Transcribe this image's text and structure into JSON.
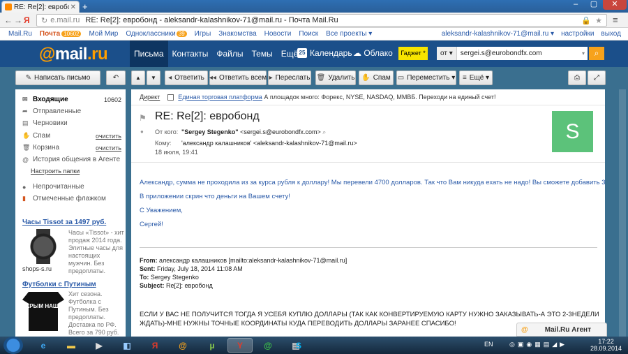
{
  "browser": {
    "tab_title": "RE: Re[2]: евробонд - ",
    "url_host": "e.mail.ru",
    "url_title": "RE: Re[2]: евробонд - aleksandr-kalashnikov-71@mail.ru - Почта Mail.Ru"
  },
  "portal": {
    "links": [
      "Mail.Ru",
      "Почта",
      "Мой Мир",
      "Одноклассники",
      "Игры",
      "Знакомства",
      "Новости",
      "Поиск",
      "Все проекты ▾"
    ],
    "mail_count": "10602",
    "ok_count": "39",
    "user": "aleksandr-kalashnikov-71@mail.ru ▾",
    "settings": "настройки",
    "logout": "выход"
  },
  "header": {
    "logo_at": "@",
    "logo_mail": "mail",
    "logo_ru": ".ru",
    "nav": [
      "Письма",
      "Контакты",
      "Файлы",
      "Темы",
      "Ещё"
    ],
    "calendar": "Календарь",
    "calendar_day": "25",
    "cloud": "Облако",
    "gadget": "Гаджет *",
    "search_scope": "от ▾",
    "search_value": "sergei.s@eurobondfx.com"
  },
  "toolbar": {
    "compose": "Написать письмо",
    "reply": "Ответить",
    "reply_all": "Ответить всем",
    "forward": "Переслать",
    "delete": "Удалить",
    "spam": "Спам",
    "move": "Переместить ▾",
    "more": "Ещё ▾"
  },
  "sidebar": {
    "folders": [
      {
        "label": "Входящие",
        "count": "10602"
      },
      {
        "label": "Отправленные"
      },
      {
        "label": "Черновики"
      },
      {
        "label": "Спам",
        "action": "очистить"
      },
      {
        "label": "Корзина",
        "action": "очистить"
      },
      {
        "label": "История общения в Агенте"
      }
    ],
    "settings_link": "Настроить папки",
    "extra": [
      {
        "label": "Непрочитанные"
      },
      {
        "label": "Отмеченные флажком"
      }
    ],
    "ads": [
      {
        "title": "Часы Tissot за 1497 руб.",
        "text": "Часы «Tissot» - хит продаж 2014 года. Элитные часы для настоящих мужчин. Без предоплаты.",
        "domain": "shops-s.ru"
      },
      {
        "title": "Футболки с Путиным",
        "text": "Хит сезона. Футболка с Путиным. Без предоплаты. Доставка по РФ. Всего за 790 руб.",
        "shirt_text": "КРЫМ НАШ!"
      }
    ]
  },
  "message": {
    "direct_label": "Директ",
    "direct_link": "Единая торговая платформа",
    "direct_text": "А площадок много: Форекс, NYSE, NASDAQ, ММВБ. Переходи на единый счет!",
    "subject": "RE: Re[2]: евробонд",
    "from_label": "От кого:",
    "from_name": "\"Sergey Stegenko\"",
    "from_email": "<sergei.s@eurobondfx.com>",
    "to_label": "Кому:",
    "to_value": "'александр калашников' <aleksandr-kalashnikov-71@mail.ru>",
    "date": "18 июля, 19:41",
    "avatar_letter": "S",
    "body": [
      "Александр, сумма не проходила из за курса рубля к доллару! Мы перевели 4700 долларов. Так что Вам никуда ехать не надо! Вы сможете добавить 300?",
      "В приложении скрин что деньги на Вашем счету!",
      "С Уважением,",
      "Сергей!"
    ],
    "quoted": {
      "from_label": "From:",
      "from_value": "александр калашников [mailto:aleksandr-kalashnikov-71@mail.ru]",
      "sent_label": "Sent:",
      "sent_value": "Friday, July 18, 2014 11:08 AM",
      "to_label": "To:",
      "to_value": "Sergey Stegenko",
      "subject_label": "Subject:",
      "subject_value": "Re[2]: евробонд",
      "text": "ЕСЛИ У ВАС НЕ ПОЛУЧИТСЯ  ТОГДА           Я УСЕБЯ КУПЛЮ ДОЛЛАРЫ (ТАК КАК    КОНВЕРТИРУЕМУЮ КАРТУ НУЖНО ЗАКАЗЫВАТЬ-А ЭТО 2-3НЕДЕЛИ ЖДАТЬ)-МНЕ НУЖНЫ ТОЧНЫЕ КООРДИНАТЫ КУДА ПЕРЕВОДИТЬ ДОЛЛАРЫ ЗАРАНЕЕ СПАСИБО!"
    }
  },
  "agent": {
    "label": "Mail.Ru Агент"
  },
  "taskbar": {
    "lang": "EN",
    "time": "17:22",
    "date": "28.09.2014"
  }
}
